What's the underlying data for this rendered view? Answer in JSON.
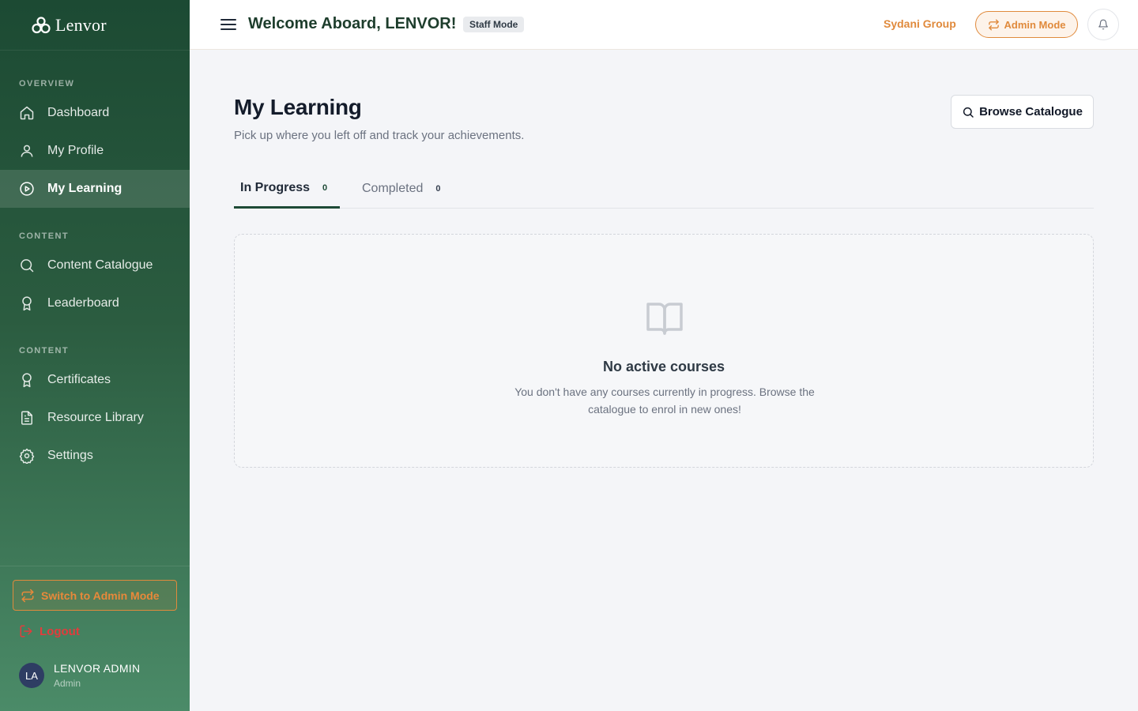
{
  "brand": {
    "name": "Lenvor"
  },
  "sidebar": {
    "sections": [
      {
        "label": "OVERVIEW"
      },
      {
        "label": "CONTENT"
      },
      {
        "label": "CONTENT"
      }
    ],
    "items": [
      {
        "label": "Dashboard",
        "icon": "home-icon"
      },
      {
        "label": "My Profile",
        "icon": "user-icon"
      },
      {
        "label": "My Learning",
        "icon": "play-circle-icon",
        "active": true
      },
      {
        "label": "Content Catalogue",
        "icon": "search-icon"
      },
      {
        "label": "Leaderboard",
        "icon": "award-icon"
      },
      {
        "label": "Certificates",
        "icon": "award-icon"
      },
      {
        "label": "Resource Library",
        "icon": "file-text-icon"
      },
      {
        "label": "Settings",
        "icon": "gear-icon"
      }
    ],
    "switch_label": "Switch to Admin Mode",
    "logout_label": "Logout",
    "user": {
      "initials": "LA",
      "name": "LENVOR ADMIN",
      "role": "Admin"
    }
  },
  "header": {
    "welcome": "Welcome Aboard, LENVOR!",
    "mode_badge": "Staff Mode",
    "org_name": "Sydani Group",
    "admin_button": "Admin Mode"
  },
  "main": {
    "title": "My Learning",
    "subtitle": "Pick up where you left off and track your achievements.",
    "browse_button": "Browse Catalogue",
    "tabs": [
      {
        "label": "In Progress",
        "count": "0",
        "active": true
      },
      {
        "label": "Completed",
        "count": "0"
      }
    ],
    "empty_state": {
      "title": "No active courses",
      "description": "You don't have any courses currently in progress. Browse the catalogue to enrol in new ones!"
    }
  },
  "colors": {
    "sidebar_dark": "#1c4a33",
    "sidebar_light": "#4b8b68",
    "accent_orange": "#e08a3c",
    "logout_red": "#e23c3c",
    "tab_active": "#1e4a36"
  }
}
